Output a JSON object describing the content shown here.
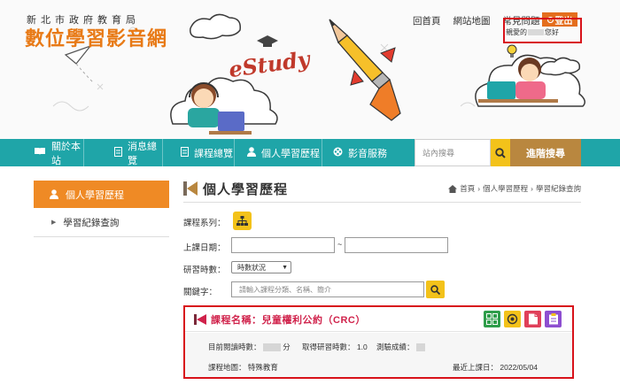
{
  "header": {
    "logo_subtitle": "新北市政府教育局",
    "logo_title": "數位學習影音網",
    "banner_text": "eStudy",
    "top_links": [
      "回首頁",
      "網站地圖",
      "常見問題"
    ],
    "logout_label": "登出",
    "greeting_prefix": "親愛的",
    "greeting_suffix": "您好"
  },
  "nav": {
    "items": [
      {
        "label": "關於本站",
        "icon": "book-icon"
      },
      {
        "label": "消息總覽",
        "icon": "document-icon"
      },
      {
        "label": "課程總覽",
        "icon": "document-icon"
      },
      {
        "label": "個人學習歷程",
        "icon": "user-icon"
      },
      {
        "label": "影音服務",
        "icon": "film-reel-icon"
      }
    ],
    "search_placeholder": "站內搜尋",
    "advanced_search_label": "進階搜尋"
  },
  "sidebar": {
    "active_label": "個人學習歷程",
    "items": [
      {
        "label": "學習紀錄查詢"
      }
    ]
  },
  "main": {
    "page_title": "個人學習歷程",
    "breadcrumb": [
      "首頁",
      "個人學習歷程",
      "學習紀錄查詢"
    ],
    "form": {
      "series_label": "課程系列：",
      "date_label": "上課日期：",
      "date_separator": "~",
      "hours_label": "研習時數：",
      "hours_selected": "時數狀況",
      "keyword_label": "關鍵字：",
      "keyword_placeholder": "請輸入課程分類、名稱、簡介"
    },
    "course": {
      "title": "課程名稱：兒童權利公約（CRC）",
      "read_hours_label": "目前閱讀時數：",
      "read_hours_unit": "分",
      "earned_hours_label": "取得研習時數：",
      "earned_hours_value": "1.0",
      "quiz_label": "測驗成績：",
      "map_label": "課程地圖：",
      "map_value": "特殊教育",
      "last_date_label": "最近上課日：",
      "last_date_value": "2022/05/04"
    }
  },
  "colors": {
    "nav_teal": "#1fa5a8",
    "accent_orange": "#ef8a25",
    "search_yellow": "#f3c21a",
    "advanced_brown": "#b9873f",
    "highlight_red": "#d8121a",
    "course_title": "#d0224b"
  }
}
